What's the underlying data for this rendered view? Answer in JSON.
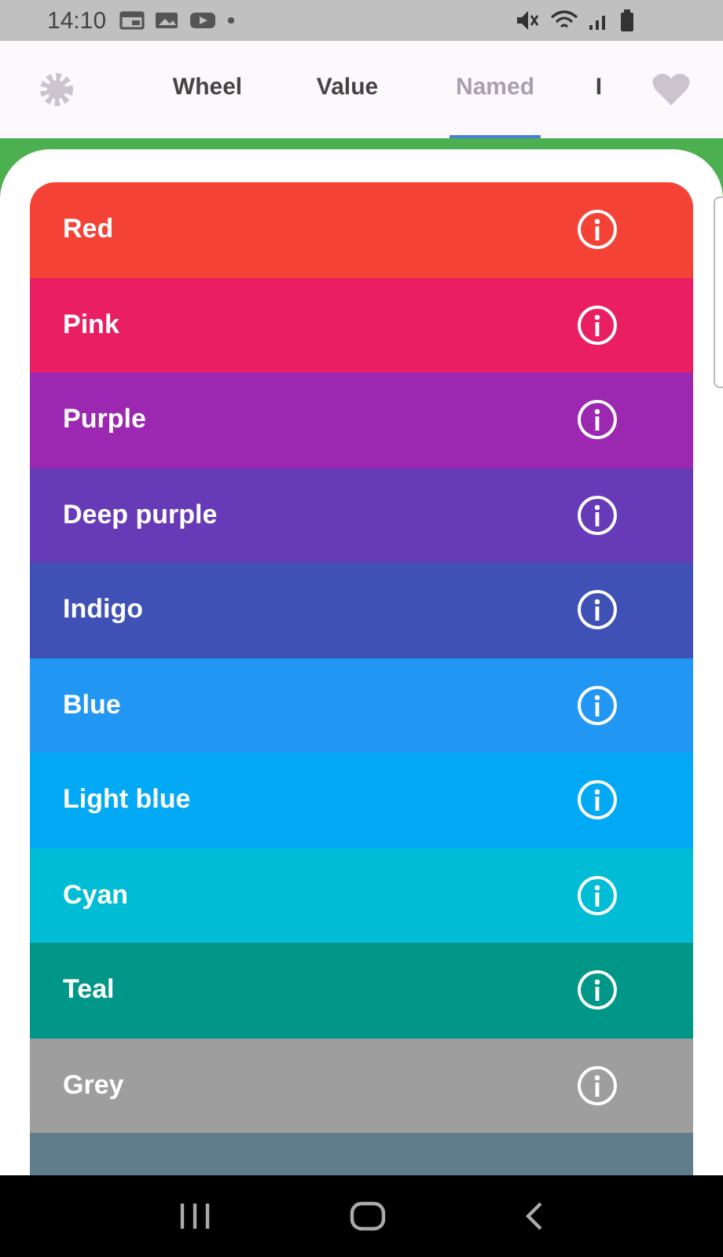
{
  "status_bar": {
    "time": "14:10"
  },
  "tabs": [
    {
      "label": "Wheel",
      "selected": false
    },
    {
      "label": "Value",
      "selected": false
    },
    {
      "label": "Named",
      "selected": true
    },
    {
      "label": "I",
      "selected": false
    }
  ],
  "colors": [
    {
      "name": "Red",
      "color": "#f44336"
    },
    {
      "name": "Pink",
      "color": "#e91e63"
    },
    {
      "name": "Purple",
      "color": "#9c27b0"
    },
    {
      "name": "Deep purple",
      "color": "#673ab7"
    },
    {
      "name": "Indigo",
      "color": "#3f51b5"
    },
    {
      "name": "Blue",
      "color": "#2196f3"
    },
    {
      "name": "Light blue",
      "color": "#03a9f4"
    },
    {
      "name": "Cyan",
      "color": "#00bcd4"
    },
    {
      "name": "Teal",
      "color": "#009688"
    },
    {
      "name": "Grey",
      "color": "#9e9e9e"
    },
    {
      "color": "#607d8b"
    }
  ]
}
